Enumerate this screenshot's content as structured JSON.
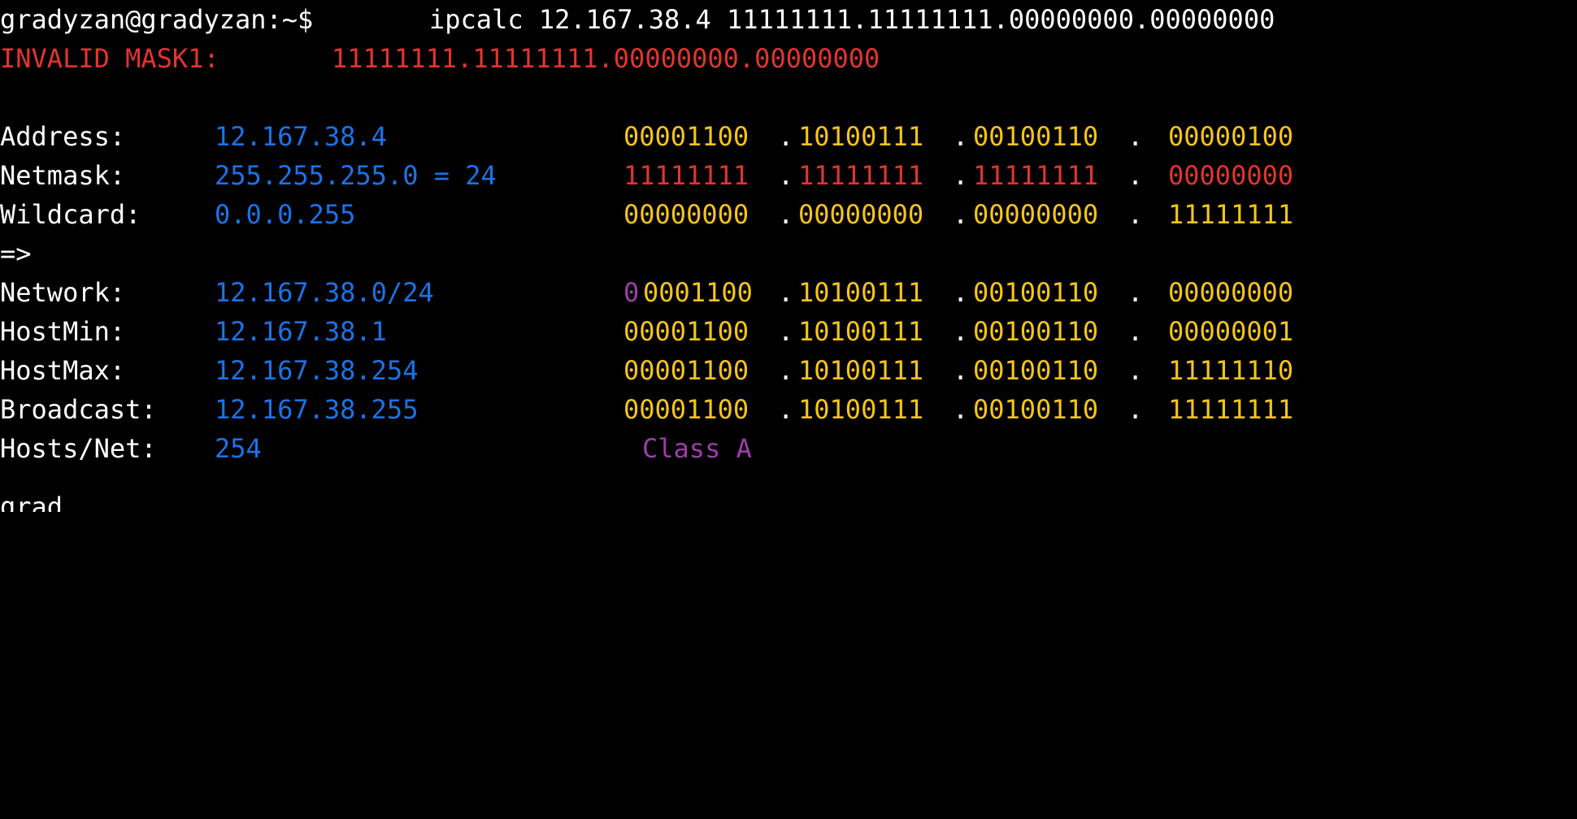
{
  "terminal": {
    "prompt": "gradyzan@gradyzan:~$ ",
    "command": "ipcalc 12.167.38.4 11111111.11111111.00000000.00000000",
    "invalid_label": "INVALID MASK1:",
    "invalid_value": "11111111.11111111.00000000.00000000",
    "rows": {
      "address": {
        "label": "Address:",
        "value": "12.167.38.4",
        "b1": "00001100",
        "b2": "10100111",
        "b3": "00100110",
        "b4": "00000100"
      },
      "netmask": {
        "label": "Netmask:",
        "value": "255.255.255.0 = 24",
        "b1": "11111111",
        "b2": "11111111",
        "b3": "11111111",
        "b4": "00000000"
      },
      "wildcard": {
        "label": "Wildcard:",
        "value": "0.0.0.255",
        "b1": "00000000",
        "b2": "00000000",
        "b3": "00000000",
        "b4": "11111111"
      },
      "arrow": "=>",
      "network": {
        "label": "Network:",
        "value": "12.167.38.0/24",
        "class_bit": "0",
        "b1_rest": "0001100",
        "b2": "10100111",
        "b3": "00100110",
        "b4": "00000000"
      },
      "hostmin": {
        "label": "HostMin:",
        "value": "12.167.38.1",
        "b1": "00001100",
        "b2": "10100111",
        "b3": "00100110",
        "b4": "00000001"
      },
      "hostmax": {
        "label": "HostMax:",
        "value": "12.167.38.254",
        "b1": "00001100",
        "b2": "10100111",
        "b3": "00100110",
        "b4": "11111110"
      },
      "broadcast": {
        "label": "Broadcast:",
        "value": "12.167.38.255",
        "b1": "00001100",
        "b2": "10100111",
        "b3": "00100110",
        "b4": "11111111"
      },
      "hosts": {
        "label": "Hosts/Net:",
        "value": "254",
        "class_label": "Class A"
      }
    },
    "next_prompt": "gradyzan@gradyzan:~$"
  }
}
